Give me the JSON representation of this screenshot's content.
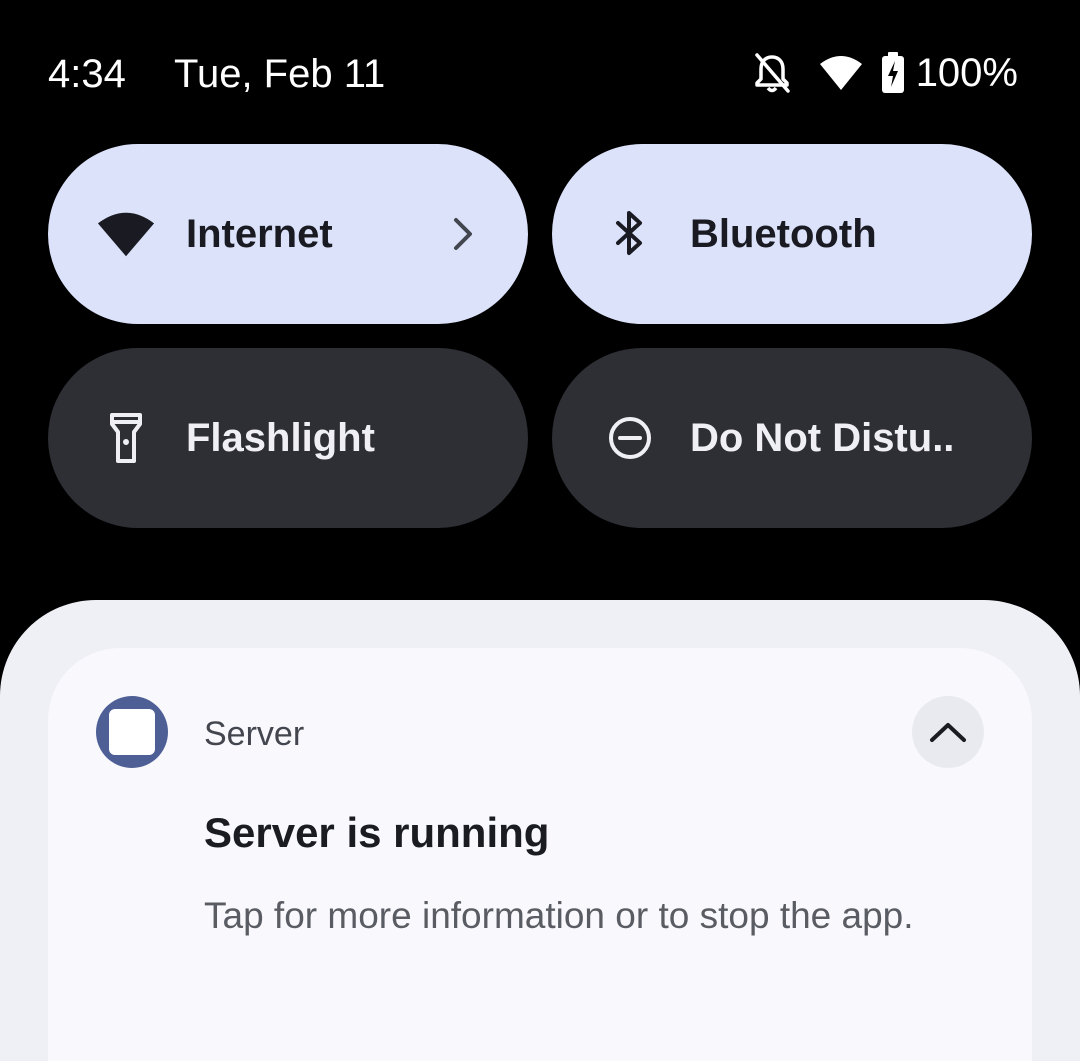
{
  "status_bar": {
    "time": "4:34",
    "date": "Tue, Feb 11",
    "icons": [
      "notifications-off-icon",
      "wifi-icon",
      "battery-charging-icon"
    ],
    "battery_percent": "100%"
  },
  "quick_settings": {
    "tiles": [
      {
        "label": "Internet",
        "icon": "wifi-icon",
        "active": true,
        "has_chevron": true
      },
      {
        "label": "Bluetooth",
        "icon": "bluetooth-icon",
        "active": true
      },
      {
        "label": "Flashlight",
        "icon": "flashlight-icon",
        "active": false
      },
      {
        "label": "Do Not Distu..",
        "icon": "do-not-disturb-icon",
        "active": false
      }
    ]
  },
  "notification": {
    "app_name": "Server",
    "app_icon": "square-app-icon",
    "title": "Server is running",
    "body": "Tap for more information or to stop the app.",
    "expand_icon": "chevron-up-icon"
  },
  "colors": {
    "background": "#000000",
    "tile_active": "#dbe2fa",
    "tile_inactive": "#2e2f35",
    "shade": "#eff0f5",
    "card": "#f8f8fd",
    "app_icon": "#4e5f96"
  }
}
